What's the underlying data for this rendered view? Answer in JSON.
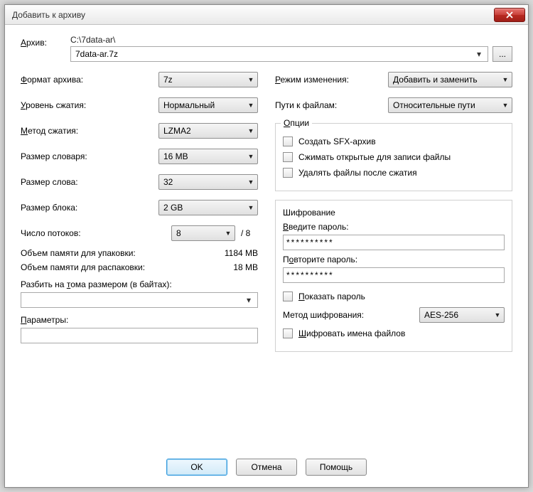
{
  "window": {
    "title": "Добавить к архиву"
  },
  "archive": {
    "label": "Архив:",
    "path": "C:\\7data-ar\\",
    "filename": "7data-ar.7z",
    "browse_label": "..."
  },
  "left": {
    "format_label": "Формат архива:",
    "format_value": "7z",
    "level_label": "Уровень сжатия:",
    "level_value": "Нормальный",
    "method_label": "Метод сжатия:",
    "method_value": "LZMA2",
    "dict_label": "Размер словаря:",
    "dict_value": "16 MB",
    "word_label": "Размер слова:",
    "word_value": "32",
    "block_label": "Размер блока:",
    "block_value": "2 GB",
    "threads_label": "Число потоков:",
    "threads_value": "8",
    "threads_suffix": "/ 8",
    "mem_pack_label": "Объем памяти для упаковки:",
    "mem_pack_value": "1184 MB",
    "mem_unpack_label": "Объем памяти для распаковки:",
    "mem_unpack_value": "18 MB",
    "split_label": "Разбить на тома размером (в байтах):",
    "split_value": "",
    "params_label": "Параметры:",
    "params_value": ""
  },
  "right": {
    "update_mode_label": "Режим изменения:",
    "update_mode_value": "Добавить и заменить",
    "path_mode_label": "Пути к файлам:",
    "path_mode_value": "Относительные пути",
    "options_legend": "Опции",
    "opt_sfx": "Создать SFX-архив",
    "opt_openfiles": "Сжимать открытые для записи файлы",
    "opt_delete": "Удалять файлы после сжатия",
    "encryption_legend": "Шифрование",
    "pwd1_label": "Введите пароль:",
    "pwd1_value": "**********",
    "pwd2_label": "Повторите пароль:",
    "pwd2_value": "**********",
    "show_pwd": "Показать пароль",
    "enc_method_label": "Метод шифрования:",
    "enc_method_value": "AES-256",
    "enc_names": "Шифровать имена файлов"
  },
  "footer": {
    "ok": "OK",
    "cancel": "Отмена",
    "help": "Помощь"
  }
}
